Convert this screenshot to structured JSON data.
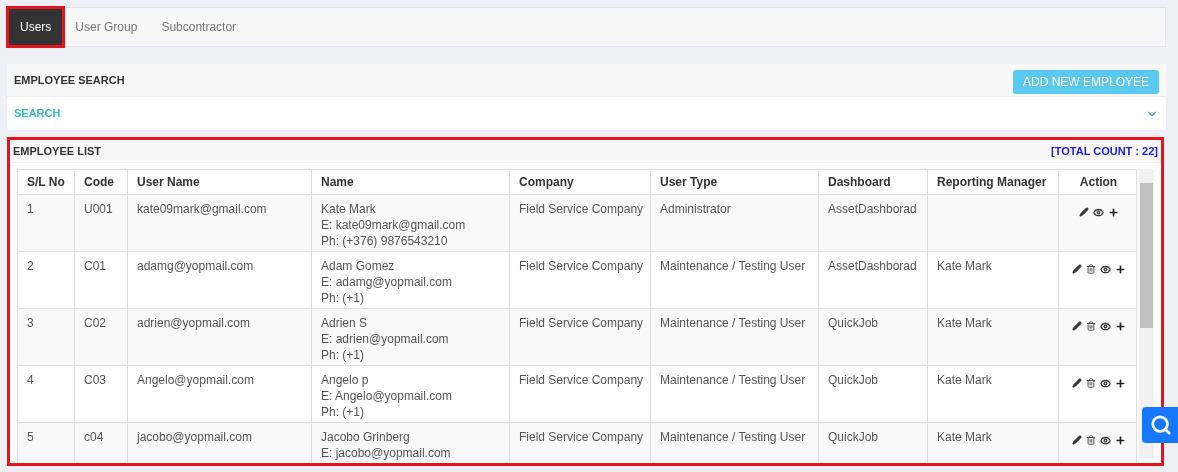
{
  "tabs": [
    {
      "label": "Users",
      "selected": true,
      "highlighted": true
    },
    {
      "label": "User Group",
      "selected": false,
      "highlighted": false
    },
    {
      "label": "Subcontractor",
      "selected": false,
      "highlighted": false
    }
  ],
  "search_panel": {
    "title": "EMPLOYEE SEARCH",
    "button": "ADD NEW EMPLOYEE",
    "section": "SEARCH",
    "expanded": false
  },
  "employee_list": {
    "title": "EMPLOYEE LIST",
    "total_count": "[TOTAL COUNT : 22]",
    "highlighted": true,
    "columns": [
      "S/L No",
      "Code",
      "User Name",
      "Name",
      "Company",
      "User Type",
      "Dashboard",
      "Reporting Manager",
      "Action"
    ],
    "rows": [
      {
        "sl": "1",
        "code": "U001",
        "user_name": "kate09mark@gmail.com",
        "name": [
          "Kate Mark",
          "E: kate09mark@gmail.com",
          "Ph: (+376) 9876543210"
        ],
        "company": "Field Service Company",
        "user_type": "Administrator",
        "dashboard": "AssetDashborad",
        "reporting_manager": "",
        "actions": [
          {
            "kind": "edit"
          },
          {
            "kind": "view"
          },
          {
            "kind": "add"
          }
        ]
      },
      {
        "sl": "2",
        "code": "C01",
        "user_name": "adamg@yopmail.com",
        "name": [
          "Adam Gomez",
          "E: adamg@yopmail.com",
          "Ph: (+1)"
        ],
        "company": "Field Service Company",
        "user_type": "Maintenance / Testing User",
        "dashboard": "AssetDashborad",
        "reporting_manager": "Kate Mark",
        "actions": [
          {
            "kind": "edit"
          },
          {
            "kind": "delete"
          },
          {
            "kind": "view"
          },
          {
            "kind": "add"
          }
        ]
      },
      {
        "sl": "3",
        "code": "C02",
        "user_name": "adrien@yopmail.com",
        "name": [
          "Adrien S",
          "E: adrien@yopmail.com",
          "Ph: (+1)"
        ],
        "company": "Field Service Company",
        "user_type": "Maintenance / Testing User",
        "dashboard": "QuickJob",
        "reporting_manager": "Kate Mark",
        "actions": [
          {
            "kind": "edit"
          },
          {
            "kind": "delete"
          },
          {
            "kind": "view"
          },
          {
            "kind": "add"
          }
        ]
      },
      {
        "sl": "4",
        "code": "C03",
        "user_name": "Angelo@yopmail.com",
        "name": [
          "Angelo p",
          "E: Angelo@yopmail.com",
          "Ph: (+1)"
        ],
        "company": "Field Service Company",
        "user_type": "Maintenance / Testing User",
        "dashboard": "QuickJob",
        "reporting_manager": "Kate Mark",
        "actions": [
          {
            "kind": "edit"
          },
          {
            "kind": "delete"
          },
          {
            "kind": "view"
          },
          {
            "kind": "add"
          }
        ]
      },
      {
        "sl": "5",
        "code": "c04",
        "user_name": "jacobo@yopmail.com",
        "name": [
          "Jacobo Grinberg",
          "E: jacobo@yopmail.com"
        ],
        "company": "Field Service Company",
        "user_type": "Maintenance / Testing User",
        "dashboard": "QuickJob",
        "reporting_manager": "Kate Mark",
        "actions": [
          {
            "kind": "edit"
          },
          {
            "kind": "delete"
          },
          {
            "kind": "view"
          },
          {
            "kind": "add"
          }
        ]
      }
    ]
  }
}
